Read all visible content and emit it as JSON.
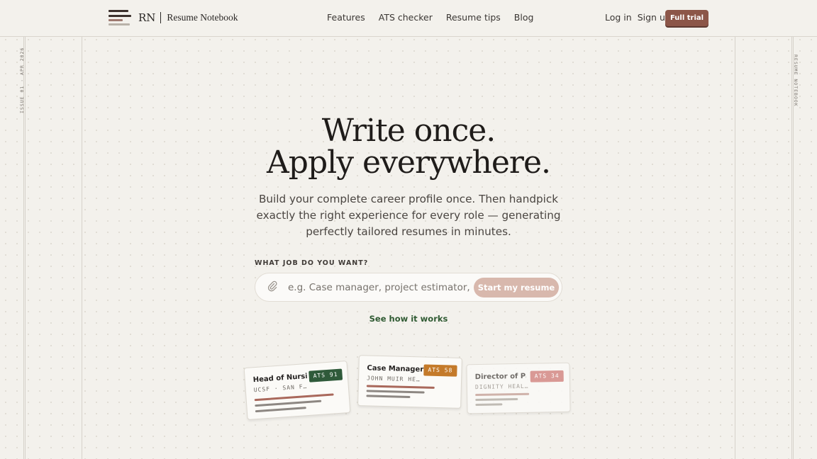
{
  "nav": {
    "brand_initials": "RN",
    "brand_name": "Resume Notebook",
    "links": [
      "Features",
      "ATS checker",
      "Resume tips",
      "Blog"
    ],
    "login": "Log in",
    "signup": "Sign up",
    "cta": "Full trial"
  },
  "margin_text": {
    "left": "ISSUE 01 · APR 2026",
    "right": "RESUME NOTEBOOK"
  },
  "hero": {
    "line1": "Write once.",
    "line2": "Apply everywhere.",
    "subtitle": "Build your complete career profile once. Then handpick exactly the right experience for every role — generating perfectly tailored resumes in minutes."
  },
  "job_form": {
    "label": "WHAT JOB DO YOU WANT?",
    "placeholder": "e.g. Case manager, project estimator, teacher",
    "value": "",
    "submit": "Start my resume",
    "attach_icon": "paperclip-icon"
  },
  "how_link": "See how it works",
  "cards": [
    {
      "title": "Head of Nursi…",
      "subtitle": "UCSF · SAN F…",
      "ats": "ATS 91",
      "ats_color": "#2f5a3a"
    },
    {
      "title": "Case Manager",
      "subtitle": "JOHN MUIR HE…",
      "ats": "ATS 58",
      "ats_color": "#c47a2a"
    },
    {
      "title": "Director of Pa…",
      "subtitle": "DIGNITY HEAL…",
      "ats": "ATS 34",
      "ats_color": "#d58a86"
    }
  ],
  "colors": {
    "accent": "#8c5648",
    "link_green": "#2f5a32",
    "background": "#f3f1ec"
  }
}
